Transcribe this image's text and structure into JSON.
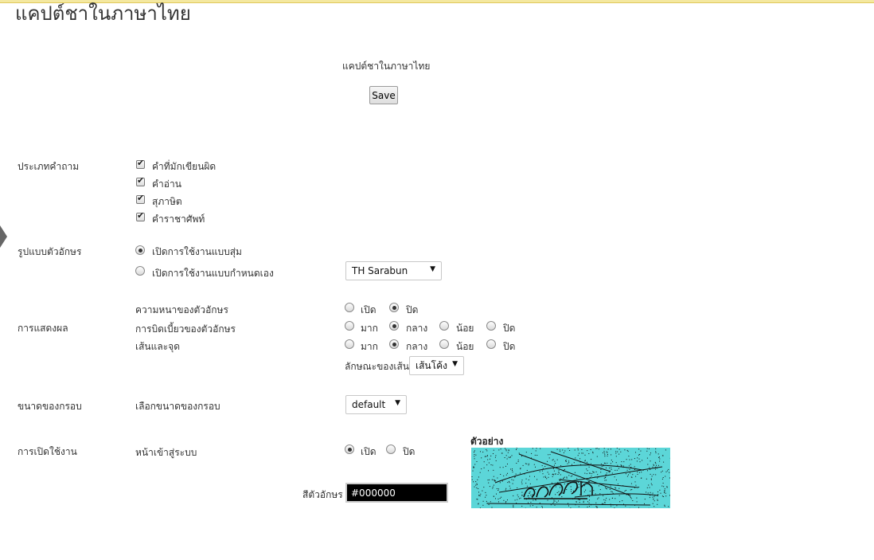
{
  "page": {
    "title": "แคปต์ชาในภาษาไทย",
    "subtitle": "แคปต์ชาในภาษาไทย",
    "save_label": "Save"
  },
  "question_types": {
    "label": "ประเภทคำถาม",
    "options": [
      {
        "label": "คำที่มักเขียนผิด",
        "checked": true
      },
      {
        "label": "คำอ่าน",
        "checked": true
      },
      {
        "label": "สุภาษิต",
        "checked": true
      },
      {
        "label": "คำราชาศัพท์",
        "checked": true
      }
    ]
  },
  "font_style": {
    "label": "รูปแบบตัวอักษร",
    "random_label": "เปิดการใช้งานแบบสุ่ม",
    "custom_label": "เปิดการใช้งานแบบกำหนดเอง",
    "selected": "random",
    "font_select_value": "TH Sarabun"
  },
  "display": {
    "label": "การแสดงผล",
    "bold_label": "ความหนาของตัวอักษร",
    "bold_options": [
      "เปิด",
      "ปิด"
    ],
    "bold_selected": "ปิด",
    "distort_label": "การบิดเบี้ยวของตัวอักษร",
    "distort_options": [
      "มาก",
      "กลาง",
      "น้อย",
      "ปิด"
    ],
    "distort_selected": "กลาง",
    "lines_label": "เส้นและจุด",
    "lines_options": [
      "มาก",
      "กลาง",
      "น้อย",
      "ปิด"
    ],
    "lines_selected": "กลาง",
    "line_style_label": "ลักษณะของเส้น",
    "line_style_value": "เส้นโค้ง"
  },
  "frame_size": {
    "label": "ขนาดของกรอบ",
    "select_label": "เลือกขนาดของกรอบ",
    "value": "default"
  },
  "enable": {
    "label": "การเปิดใช้งาน",
    "login_label": "หน้าเข้าสู่ระบบ",
    "options": [
      "เปิด",
      "ปิด"
    ],
    "selected": "เปิด"
  },
  "font_color": {
    "label": "สีตัวอักษร",
    "value": "#000000"
  },
  "preview": {
    "label": "ตัวอย่าง",
    "background": "#5cd6d8"
  },
  "colors": {
    "preview_bg": "#5cd6d8",
    "color_input_bg": "#000000"
  }
}
